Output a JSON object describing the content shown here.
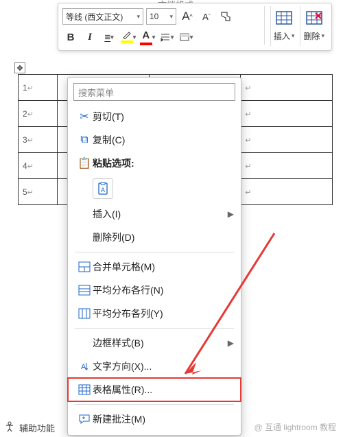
{
  "title_fragment": "文档格式",
  "ribbon": {
    "font_name": "等线 (西文正文)",
    "font_size": "10",
    "grow_font": "A",
    "shrink_font": "A",
    "bold": "B",
    "italic": "I",
    "underline": "U",
    "font_tool": "A",
    "insert_label": "插入",
    "delete_label": "删除"
  },
  "table": {
    "handle": "✥",
    "rows": [
      {
        "num": "1",
        "mark": "↵"
      },
      {
        "num": "2",
        "mark": "↵"
      },
      {
        "num": "3",
        "mark": "↵"
      },
      {
        "num": "4",
        "mark": "↵"
      },
      {
        "num": "5",
        "mark": "↵"
      }
    ]
  },
  "menu": {
    "search_placeholder": "搜索菜单",
    "items": {
      "cut": "剪切(T)",
      "copy": "复制(C)",
      "paste_options": "粘贴选项:",
      "paste_text_sub": "A",
      "insert": "插入(I)",
      "delete_col": "删除列(D)",
      "merge_cells": "合并单元格(M)",
      "distribute_rows": "平均分布各行(N)",
      "distribute_cols": "平均分布各列(Y)",
      "border_style": "边框样式(B)",
      "text_direction": "文字方向(X)...",
      "table_props": "表格属性(R)...",
      "new_comment": "新建批注(M)"
    }
  },
  "footer": {
    "accessibility": "辅助功能"
  },
  "watermark": "@ 互通 lightroom 教程"
}
